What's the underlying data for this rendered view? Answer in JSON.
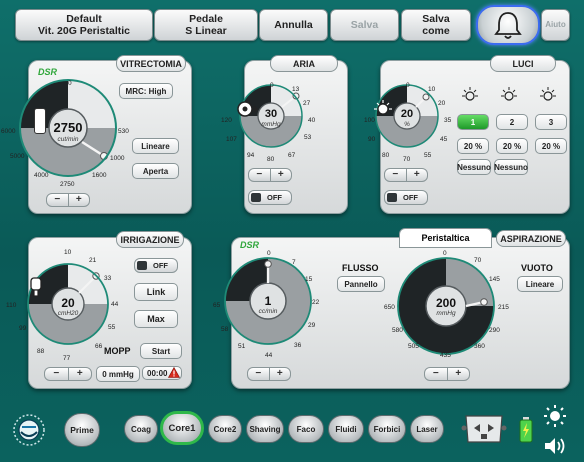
{
  "topbar": {
    "btn1_line1": "Default",
    "btn1_line2": "Vit. 20G Peristaltic",
    "btn2_line1": "Pedale",
    "btn2_line2": "S Linear",
    "annulla": "Annulla",
    "salva": "Salva",
    "salva_come_line1": "Salva",
    "salva_come_line2": "come",
    "aiuto": "Aiuto"
  },
  "vitrectomia": {
    "title": "VITRECTOMIA",
    "brand": "DSR",
    "mrc": "MRC: High",
    "value": "2750",
    "unit": "cut/min",
    "mode": "Lineare",
    "port": "Aperta",
    "ticks": [
      "0",
      "530",
      "1000",
      "1600",
      "2750",
      "4000",
      "5000",
      "6000"
    ],
    "level": 2750
  },
  "aria": {
    "title": "ARIA",
    "value": "30",
    "unit": "mmHg",
    "toggle": "OFF",
    "ticks": [
      "0",
      "13",
      "27",
      "40",
      "53",
      "67",
      "80",
      "94",
      "107",
      "120"
    ],
    "level": 30
  },
  "luci": {
    "title": "LUCI",
    "value": "20",
    "unit": "%",
    "toggle": "OFF",
    "ticks": [
      "0",
      "10",
      "20",
      "35",
      "45",
      "55",
      "70",
      "80",
      "90",
      "100"
    ],
    "tabs": [
      "1",
      "2",
      "3"
    ],
    "percents": [
      "20 %",
      "20 %",
      "20 %"
    ],
    "filters": [
      "Nessuno",
      "Nessuno",
      "Nessuno"
    ],
    "level": 20
  },
  "irrigazione": {
    "title": "IRRIGAZIONE",
    "value": "20",
    "unit": "cmH20",
    "toggle": "OFF",
    "link": "Link",
    "max": "Max",
    "mopp": "MOPP",
    "start": "Start",
    "pressure": "0 mmHg",
    "timer": "00:00",
    "ticks": [
      "10",
      "21",
      "33",
      "44",
      "55",
      "66",
      "77",
      "88",
      "99",
      "110"
    ],
    "level": 20
  },
  "pump": {
    "brand": "DSR",
    "tab_active": "Peristaltica",
    "tab_other": "ASPIRAZIONE",
    "flusso_label": "FLUSSO",
    "flusso_mode": "Pannello",
    "flusso_value": "1",
    "flusso_unit": "cc/min",
    "flusso_ticks": [
      "0",
      "7",
      "15",
      "22",
      "29",
      "36",
      "44",
      "51",
      "58",
      "65"
    ],
    "flusso_level": 1,
    "vuoto_label": "VUOTO",
    "vuoto_mode": "Lineare",
    "vuoto_value": "200",
    "vuoto_unit": "mmHg",
    "vuoto_ticks": [
      "0",
      "70",
      "145",
      "215",
      "290",
      "360",
      "435",
      "505",
      "580",
      "650"
    ],
    "vuoto_level": 200
  },
  "bottom": {
    "buttons": [
      "Prime",
      "Coag",
      "Core1",
      "Core2",
      "Shaving",
      "Faco",
      "Fluidi",
      "Forbici",
      "Laser"
    ],
    "active": "Core1"
  },
  "colors": {
    "accent_green": "#2fb84a",
    "teal_bg": "#0f6f6a",
    "active_ring": "#2fb84a"
  }
}
